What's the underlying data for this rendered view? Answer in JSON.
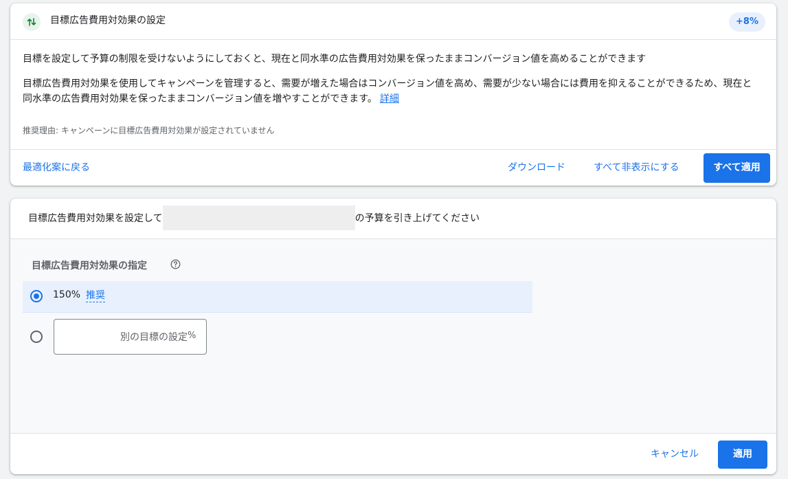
{
  "recommendation": {
    "title": "目標広告費用対効果の設定",
    "uplift_badge": "+8%",
    "description_1": "目標を設定して予算の制限を受けないようにしておくと、現在と同水準の広告費用対効果を保ったままコンバージョン値を高めることができます",
    "description_2": "目標広告費用対効果を使用してキャンペーンを管理すると、需要が増えた場合はコンバージョン値を高め、需要が少ない場合には費用を抑えることができるため、現在と同水準の広告費用対効果を保ったままコンバージョン値を増やすことができます。",
    "details_link": "詳細",
    "reason": "推奨理由: キャンペーンに目標広告費用対効果が設定されていません",
    "back_link": "最適化案に戻る",
    "download_button": "ダウンロード",
    "dismiss_all_button": "すべて非表示にする",
    "apply_all_button": "すべて適用"
  },
  "campaign_card": {
    "title_prefix": "目標広告費用対効果を設定して",
    "title_suffix": "の予算を引き上げてください",
    "section_label": "目標広告費用対効果の指定",
    "options": [
      {
        "value": "150%",
        "tag": "推奨",
        "selected": true
      },
      {
        "placeholder": "別の目標の設定",
        "suffix": "%",
        "selected": false
      }
    ],
    "cancel_button": "キャンセル",
    "apply_button": "適用"
  },
  "colors": {
    "accent": "#1a73e8",
    "selected_row": "#e8f0fe",
    "badge_bg": "#e8f0fe",
    "trend_icon": "#188038"
  }
}
